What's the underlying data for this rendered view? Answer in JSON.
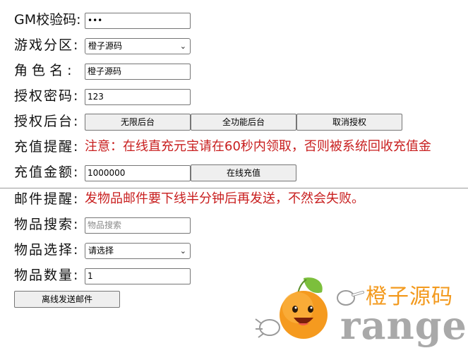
{
  "form": {
    "gm_code": {
      "label": "GM校验码:",
      "value": "•••"
    },
    "server": {
      "label": "游戏分区:",
      "selected": "橙子源码"
    },
    "role_name": {
      "label": "角 色 名 :",
      "value": "橙子源码"
    },
    "auth_password": {
      "label": "授权密码:",
      "value": "123"
    },
    "auth_backend": {
      "label": "授权后台:",
      "buttons": [
        "无限后台",
        "全功能后台",
        "取消授权"
      ]
    },
    "recharge_notice": {
      "label": "充值提醒:",
      "text": "注意：在线直充元宝请在60秒内领取，否则被系统回收充值金"
    },
    "recharge_amount": {
      "label": "充值金额:",
      "value": "1000000",
      "button": "在线充值"
    },
    "mail_notice": {
      "label": "邮件提醒:",
      "text": "发物品邮件要下线半分钟后再发送，不然会失败。"
    },
    "item_search": {
      "label": "物品搜索:",
      "placeholder": "物品搜索"
    },
    "item_select": {
      "label": "物品选择:",
      "selected": "请选择"
    },
    "item_quantity": {
      "label": "物品数量:",
      "value": "1"
    },
    "send_mail_button": "离线发送邮件"
  },
  "watermark": {
    "cn_orange": "橙子",
    "cn_gray": "源码",
    "en": "range"
  },
  "colors": {
    "notice_red": "#c81e1e",
    "logo_orange": "#f39a1e",
    "logo_gray": "#a9a9a9"
  }
}
